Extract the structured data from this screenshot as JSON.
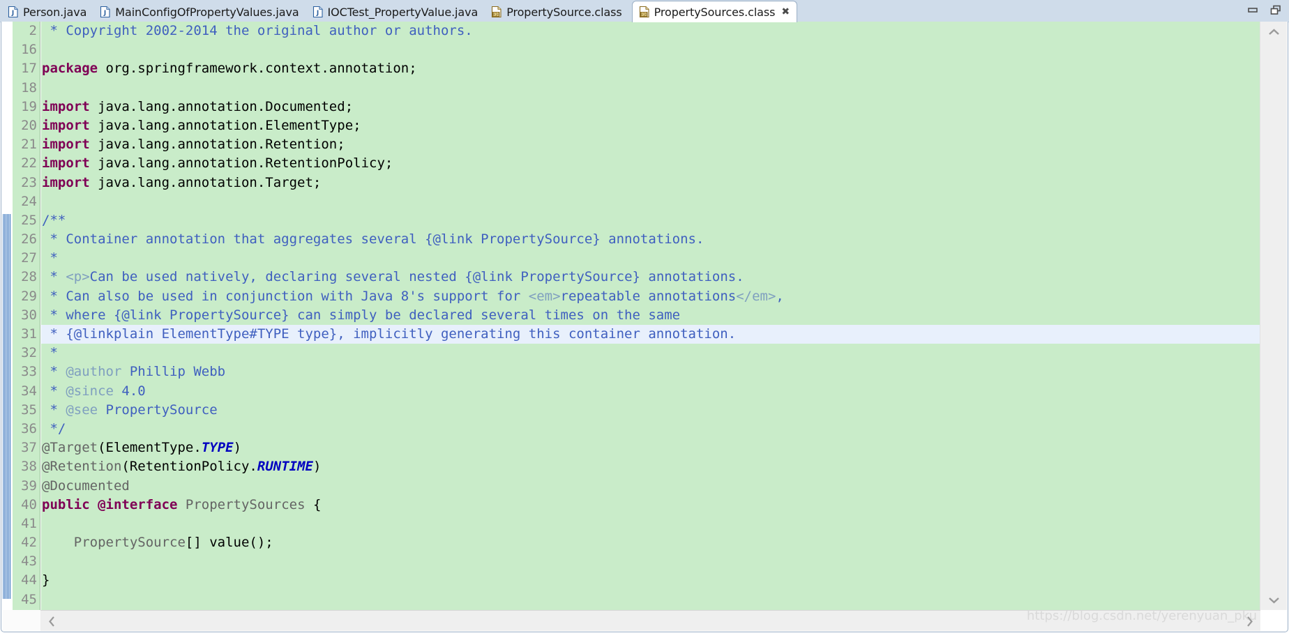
{
  "window": {
    "minimize_label": "Minimize",
    "restore_label": "Restore",
    "watermark": "https://blog.csdn.net/yerenyuan_pku"
  },
  "tabs": [
    {
      "label": "Person.java",
      "icon": "java-file-icon",
      "active": false,
      "closable": false
    },
    {
      "label": "MainConfigOfPropertyValues.java",
      "icon": "java-file-icon",
      "active": false,
      "closable": false
    },
    {
      "label": "IOCTest_PropertyValue.java",
      "icon": "java-file-icon",
      "active": false,
      "closable": false
    },
    {
      "label": "PropertySource.class",
      "icon": "class-file-icon",
      "active": false,
      "closable": false
    },
    {
      "label": "PropertySources.class",
      "icon": "class-file-icon",
      "active": true,
      "closable": true,
      "close_glyph": "✖"
    }
  ],
  "editor": {
    "file": "PropertySources.class",
    "current_line": 31,
    "fold_collapsed_glyph": "⊕",
    "fold_expanded_glyph": "⊖",
    "scroll": {
      "up_arrow": "⌃",
      "down_arrow": "⌄",
      "left_arrow": "‹",
      "right_arrow": "›"
    },
    "colors": {
      "background": "#c9ecc9",
      "current_line": "#e8f0fc",
      "line_number": "#8a8a8a",
      "keyword": "#7f0055",
      "javadoc": "#3f5fbf",
      "javadoc_tag": "#7f9fbf",
      "type_name": "#646464",
      "static_final": "#0000c0",
      "change_bar": "#4a7fc1"
    },
    "lines": [
      {
        "num": "2",
        "fold": "collapsed",
        "tokens": [
          {
            "t": " * Copyright 2002-2014 the original author or authors.",
            "c": "jdoc"
          }
        ]
      },
      {
        "num": "16",
        "fold": "",
        "tokens": []
      },
      {
        "num": "17",
        "fold": "",
        "tokens": [
          {
            "t": "package",
            "c": "kw"
          },
          {
            "t": " org.springframework.context.annotation;",
            "c": "plain"
          }
        ]
      },
      {
        "num": "18",
        "fold": "",
        "tokens": []
      },
      {
        "num": "19",
        "fold": "",
        "tokens": [
          {
            "t": "import",
            "c": "kw"
          },
          {
            "t": " java.lang.annotation.Documented;",
            "c": "plain"
          }
        ]
      },
      {
        "num": "20",
        "fold": "",
        "tokens": [
          {
            "t": "import",
            "c": "kw"
          },
          {
            "t": " java.lang.annotation.ElementType;",
            "c": "plain"
          }
        ]
      },
      {
        "num": "21",
        "fold": "",
        "tokens": [
          {
            "t": "import",
            "c": "kw"
          },
          {
            "t": " java.lang.annotation.Retention;",
            "c": "plain"
          }
        ]
      },
      {
        "num": "22",
        "fold": "",
        "tokens": [
          {
            "t": "import",
            "c": "kw"
          },
          {
            "t": " java.lang.annotation.RetentionPolicy;",
            "c": "plain"
          }
        ]
      },
      {
        "num": "23",
        "fold": "",
        "tokens": [
          {
            "t": "import",
            "c": "kw"
          },
          {
            "t": " java.lang.annotation.Target;",
            "c": "plain"
          }
        ]
      },
      {
        "num": "24",
        "fold": "",
        "tokens": []
      },
      {
        "num": "25",
        "fold": "expanded",
        "tokens": [
          {
            "t": "/**",
            "c": "jdoc"
          }
        ]
      },
      {
        "num": "26",
        "fold": "",
        "tokens": [
          {
            "t": " * Container annotation that aggregates several {@link PropertySource} annotations.",
            "c": "jdoc"
          }
        ]
      },
      {
        "num": "27",
        "fold": "",
        "tokens": [
          {
            "t": " *",
            "c": "jdoc"
          }
        ]
      },
      {
        "num": "28",
        "fold": "",
        "tokens": [
          {
            "t": " * ",
            "c": "jdoc"
          },
          {
            "t": "<p>",
            "c": "jdhtml"
          },
          {
            "t": "Can be used natively, declaring several nested {@link PropertySource} annotations.",
            "c": "jdoc"
          }
        ]
      },
      {
        "num": "29",
        "fold": "",
        "tokens": [
          {
            "t": " * Can also be used in conjunction with Java 8's support for ",
            "c": "jdoc"
          },
          {
            "t": "<em>",
            "c": "jdhtml"
          },
          {
            "t": "repeatable annotations",
            "c": "jdoc"
          },
          {
            "t": "</em>",
            "c": "jdhtml"
          },
          {
            "t": ",",
            "c": "jdoc"
          }
        ]
      },
      {
        "num": "30",
        "fold": "",
        "tokens": [
          {
            "t": " * where {@link PropertySource} can simply be declared several times on the same",
            "c": "jdoc"
          }
        ]
      },
      {
        "num": "31",
        "fold": "",
        "current": true,
        "tokens": [
          {
            "t": " * {@linkplain ElementType#TYPE type}, implicitly generating this container annotation.",
            "c": "jdoc"
          }
        ]
      },
      {
        "num": "32",
        "fold": "",
        "tokens": [
          {
            "t": " *",
            "c": "jdoc"
          }
        ]
      },
      {
        "num": "33",
        "fold": "",
        "tokens": [
          {
            "t": " * ",
            "c": "jdoc"
          },
          {
            "t": "@author",
            "c": "jdtag"
          },
          {
            "t": " Phillip Webb",
            "c": "jdoc"
          }
        ]
      },
      {
        "num": "34",
        "fold": "",
        "tokens": [
          {
            "t": " * ",
            "c": "jdoc"
          },
          {
            "t": "@since",
            "c": "jdtag"
          },
          {
            "t": " 4.0",
            "c": "jdoc"
          }
        ]
      },
      {
        "num": "35",
        "fold": "",
        "tokens": [
          {
            "t": " * ",
            "c": "jdoc"
          },
          {
            "t": "@see",
            "c": "jdtag"
          },
          {
            "t": " PropertySource",
            "c": "jdoc"
          }
        ]
      },
      {
        "num": "36",
        "fold": "",
        "tokens": [
          {
            "t": " */",
            "c": "jdoc"
          }
        ]
      },
      {
        "num": "37",
        "fold": "",
        "tokens": [
          {
            "t": "@Target",
            "c": "anno"
          },
          {
            "t": "(",
            "c": "plain"
          },
          {
            "t": "ElementType.",
            "c": "plain"
          },
          {
            "t": "TYPE",
            "c": "statfin"
          },
          {
            "t": ")",
            "c": "plain"
          }
        ]
      },
      {
        "num": "38",
        "fold": "",
        "tokens": [
          {
            "t": "@Retention",
            "c": "anno"
          },
          {
            "t": "(",
            "c": "plain"
          },
          {
            "t": "RetentionPolicy.",
            "c": "plain"
          },
          {
            "t": "RUNTIME",
            "c": "statfin"
          },
          {
            "t": ")",
            "c": "plain"
          }
        ]
      },
      {
        "num": "39",
        "fold": "",
        "tokens": [
          {
            "t": "@Documented",
            "c": "anno"
          }
        ]
      },
      {
        "num": "40",
        "fold": "",
        "tokens": [
          {
            "t": "public @interface",
            "c": "kw"
          },
          {
            "t": " ",
            "c": "plain"
          },
          {
            "t": "PropertySources",
            "c": "type"
          },
          {
            "t": " {",
            "c": "plain"
          }
        ]
      },
      {
        "num": "41",
        "fold": "",
        "tokens": []
      },
      {
        "num": "42",
        "fold": "",
        "tokens": [
          {
            "t": "    ",
            "c": "plain"
          },
          {
            "t": "PropertySource",
            "c": "type"
          },
          {
            "t": "[] value();",
            "c": "plain"
          }
        ]
      },
      {
        "num": "43",
        "fold": "",
        "tokens": []
      },
      {
        "num": "44",
        "fold": "",
        "tokens": [
          {
            "t": "}",
            "c": "plain"
          }
        ]
      },
      {
        "num": "45",
        "fold": "",
        "tokens": []
      }
    ]
  }
}
